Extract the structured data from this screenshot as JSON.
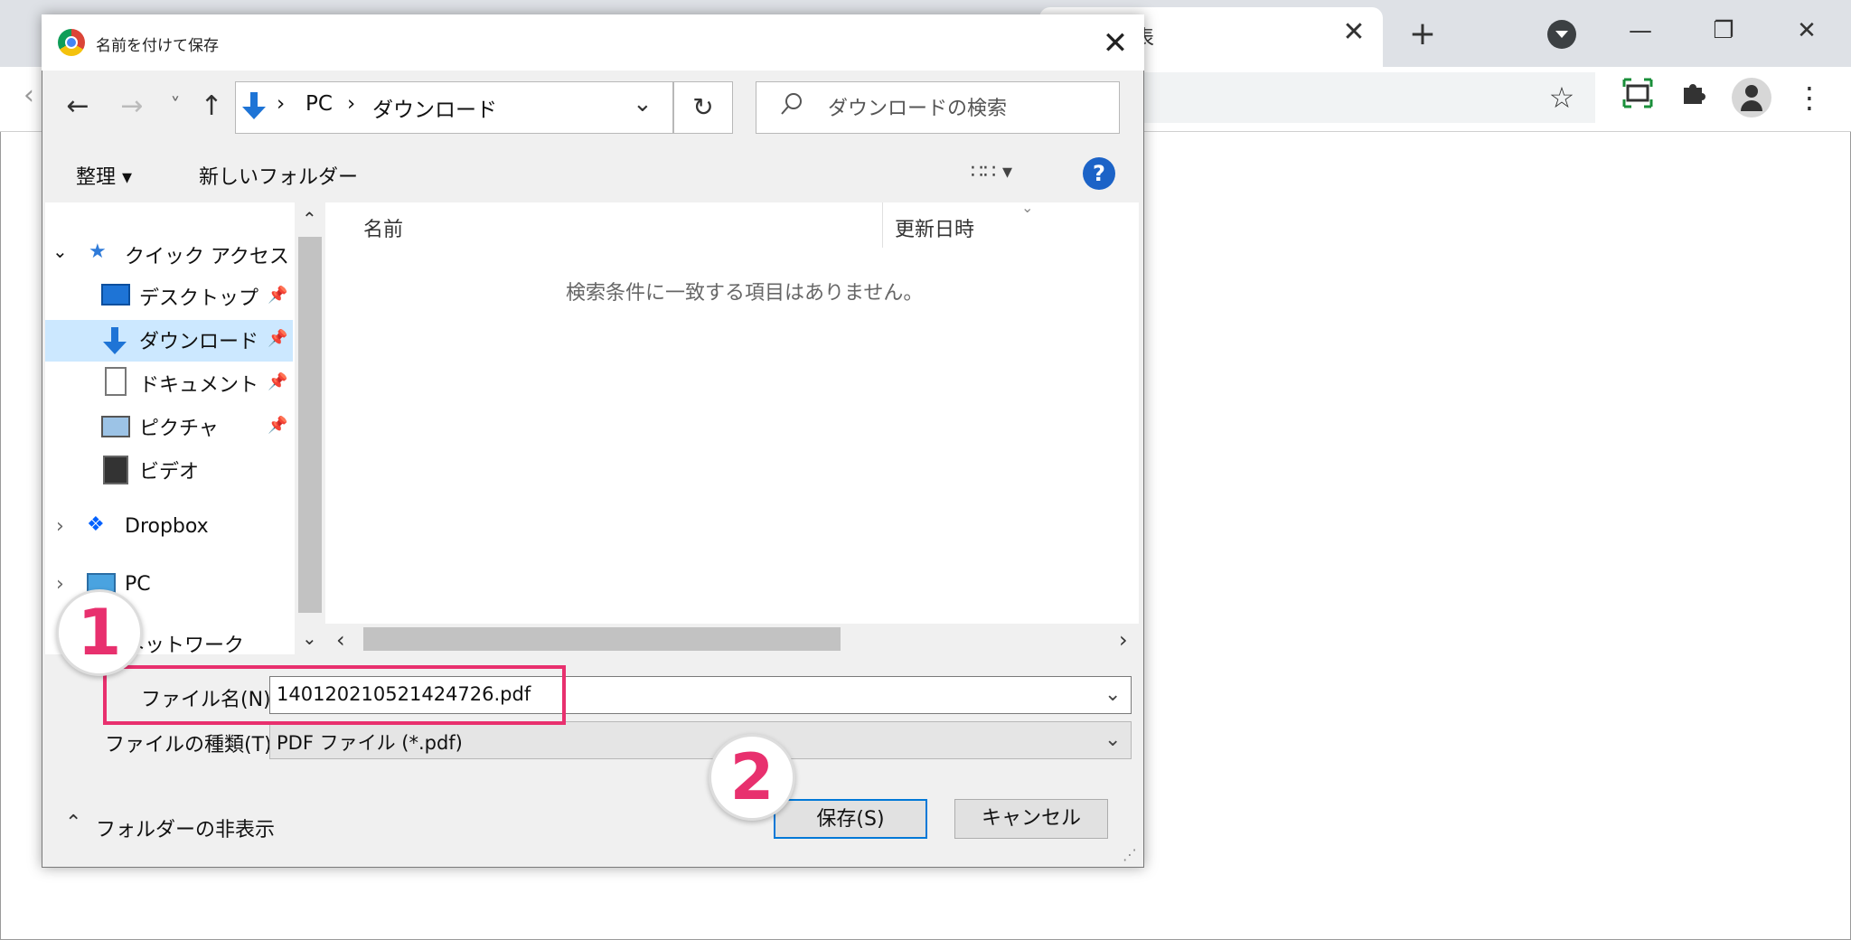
{
  "browser": {
    "tab_title": "表",
    "tab_close": "✕",
    "new_tab": "+",
    "minimize": "—",
    "restore": "❐",
    "close": "✕",
    "star": "☆",
    "menu": "⋮"
  },
  "dialog": {
    "title": "名前を付けて保存",
    "close": "✕",
    "nav": {
      "back": "←",
      "forward": "→",
      "recent": "˅",
      "up": "↑"
    },
    "path": {
      "sep1": "›",
      "pc": "PC",
      "sep2": "›",
      "folder": "ダウンロード"
    },
    "address_dropdown": "⌄",
    "refresh": "↻",
    "search_placeholder": "ダウンロードの検索",
    "toolbar": {
      "organize": "整理 ▾",
      "new_folder": "新しいフォルダー",
      "view": "∷∷ ▾",
      "help": "?"
    },
    "nav_pane": {
      "quick_access": "クイック アクセス",
      "items": [
        {
          "label": "デスクトップ"
        },
        {
          "label": "ダウンロード"
        },
        {
          "label": "ドキュメント"
        },
        {
          "label": "ピクチャ"
        },
        {
          "label": "ビデオ"
        }
      ],
      "dropbox": "Dropbox",
      "pc": "PC",
      "network": "ネットワーク"
    },
    "columns": {
      "name": "名前",
      "modified": "更新日時"
    },
    "empty_message": "検索条件に一致する項目はありません。",
    "filename_label": "ファイル名(N):",
    "filename_value": "140120210521424726.pdf",
    "filetype_label": "ファイルの種類(T):",
    "filetype_value": "PDF ファイル (*.pdf)",
    "hide_folders": "フォルダーの非表示",
    "save_button": "保存(S)",
    "cancel_button": "キャンセル"
  },
  "annotations": {
    "step1": "1",
    "step2": "2",
    "color": "#e8306e"
  }
}
